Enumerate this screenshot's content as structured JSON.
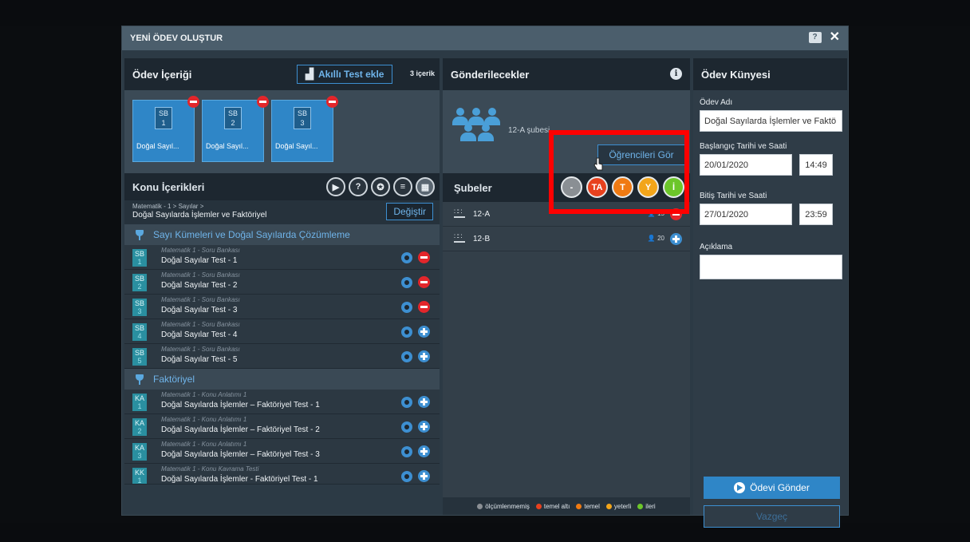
{
  "modal": {
    "title": "YENİ ÖDEV OLUŞTUR"
  },
  "odev_icerigi": {
    "title": "Ödev İçeriği",
    "add_button": "Akıllı Test ekle",
    "count": "3 içerik",
    "cards": [
      {
        "tag": "SB",
        "num": "1",
        "label": "Doğal Sayıl..."
      },
      {
        "tag": "SB",
        "num": "2",
        "label": "Doğal Sayıl..."
      },
      {
        "tag": "SB",
        "num": "3",
        "label": "Doğal Sayıl..."
      }
    ]
  },
  "konu": {
    "title": "Konu İçerikleri",
    "path": "Matematik - 1 > Sayılar >",
    "topic": "Doğal Sayılarda İşlemler ve Faktöriyel",
    "change_button": "Değiştir",
    "sections": [
      {
        "title": "Sayı Kümeleri ve Doğal Sayılarda Çözümleme",
        "items": [
          {
            "tag": "SB",
            "num": "1",
            "sub": "Matematik 1 - Soru Bankası",
            "name": "Doğal Sayılar Test - 1",
            "action": "remove"
          },
          {
            "tag": "SB",
            "num": "2",
            "sub": "Matematik 1 - Soru Bankası",
            "name": "Doğal Sayılar Test - 2",
            "action": "remove"
          },
          {
            "tag": "SB",
            "num": "3",
            "sub": "Matematik 1 - Soru Bankası",
            "name": "Doğal Sayılar Test - 3",
            "action": "remove"
          },
          {
            "tag": "SB",
            "num": "4",
            "sub": "Matematik 1 - Soru Bankası",
            "name": "Doğal Sayılar Test - 4",
            "action": "add"
          },
          {
            "tag": "SB",
            "num": "5",
            "sub": "Matematik 1 - Soru Bankası",
            "name": "Doğal Sayılar Test - 5",
            "action": "add"
          }
        ]
      },
      {
        "title": "Faktöriyel",
        "items": [
          {
            "tag": "KA",
            "num": "1",
            "sub": "Matematik 1 - Konu Anlatımı 1",
            "name": "Doğal Sayılarda İşlemler – Faktöriyel Test - 1",
            "action": "add"
          },
          {
            "tag": "KA",
            "num": "2",
            "sub": "Matematik 1 - Konu Anlatımı 1",
            "name": "Doğal Sayılarda İşlemler – Faktöriyel Test - 2",
            "action": "add"
          },
          {
            "tag": "KA",
            "num": "3",
            "sub": "Matematik 1 - Konu Anlatımı 1",
            "name": "Doğal Sayılarda İşlemler – Faktöriyel Test - 3",
            "action": "add"
          },
          {
            "tag": "KK",
            "num": "1",
            "sub": "Matematik 1 - Konu Kavrama Testi",
            "name": "Doğal Sayılarda İşlemler - Faktöriyel Test - 1",
            "action": "add"
          }
        ]
      }
    ]
  },
  "gonderilecekler": {
    "title": "Gönderilecekler",
    "summary": "12-A şubesi",
    "students_button": "Öğrencileri Gör"
  },
  "subeler": {
    "title": "Şubeler",
    "levels": [
      {
        "label": "-",
        "color": "#8a8f94"
      },
      {
        "label": "TA",
        "color": "#e8411e"
      },
      {
        "label": "T",
        "color": "#f07a12"
      },
      {
        "label": "Y",
        "color": "#f2a51a"
      },
      {
        "label": "İ",
        "color": "#6cc62a"
      }
    ],
    "rows": [
      {
        "name": "12-A",
        "count": "15",
        "action": "remove"
      },
      {
        "name": "12-B",
        "count": "20",
        "action": "add"
      }
    ],
    "legend": [
      {
        "label": "ölçümlenmemiş",
        "color": "#8a8f94"
      },
      {
        "label": "temel altı",
        "color": "#e8411e"
      },
      {
        "label": "temel",
        "color": "#f07a12"
      },
      {
        "label": "yeterli",
        "color": "#f2a51a"
      },
      {
        "label": "ileri",
        "color": "#6cc62a"
      }
    ]
  },
  "kunye": {
    "title": "Ödev Künyesi",
    "name_label": "Ödev Adı",
    "name_value": "Doğal Sayılarda İşlemler ve Faktö",
    "start_label": "Başlangıç Tarihi ve Saati",
    "start_date": "20/01/2020",
    "start_time": "14:49",
    "end_label": "Bitiş Tarihi ve Saati",
    "end_date": "27/01/2020",
    "end_time": "23:59",
    "desc_label": "Açıklama",
    "desc_value": "",
    "send_button": "Ödevi Gönder",
    "cancel_button": "Vazgeç"
  }
}
